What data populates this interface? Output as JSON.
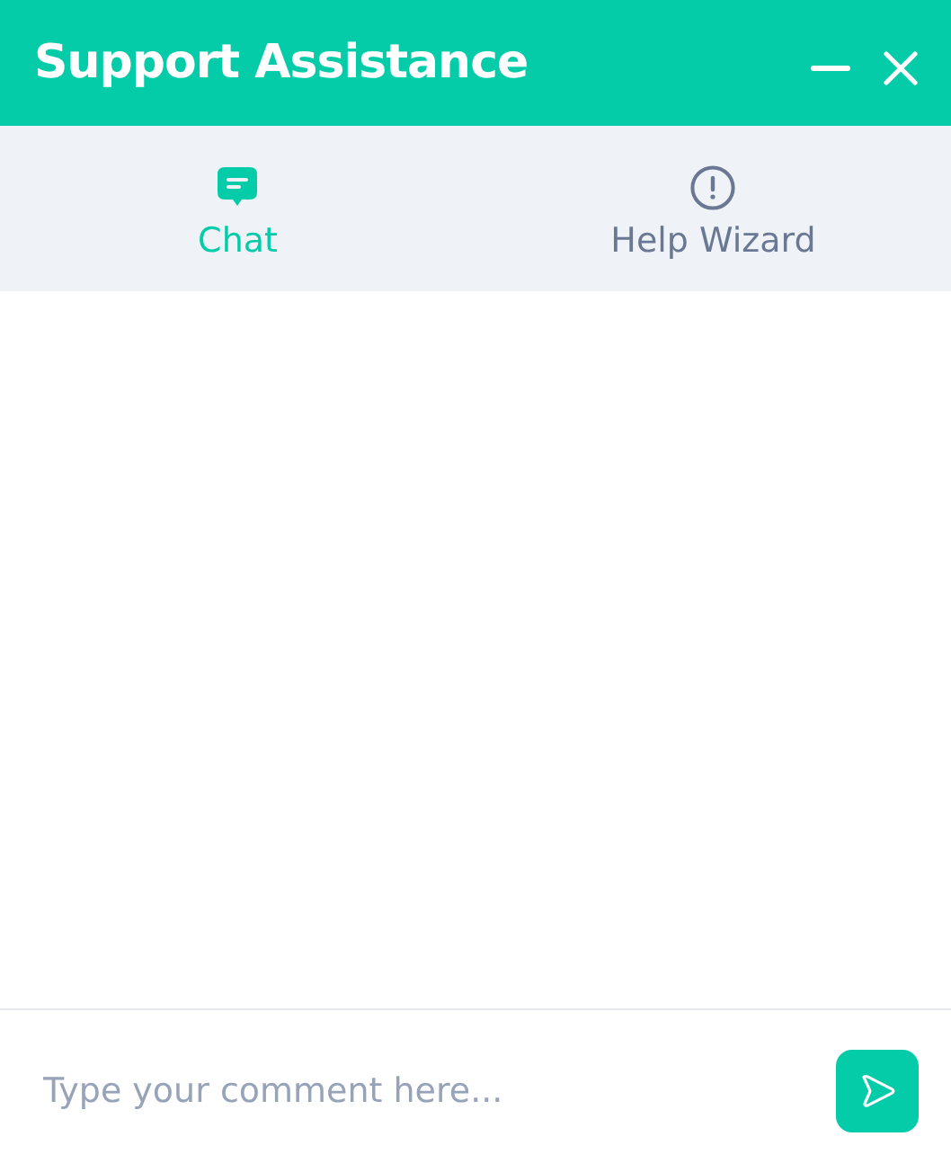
{
  "window": {
    "title": "Support Assistance"
  },
  "tabs": [
    {
      "label": "Chat",
      "kind": "chat",
      "selected": true
    },
    {
      "label": "Help Wizard",
      "kind": "info",
      "selected": false
    }
  ],
  "composer": {
    "placeholder": "Type your comment here..."
  }
}
